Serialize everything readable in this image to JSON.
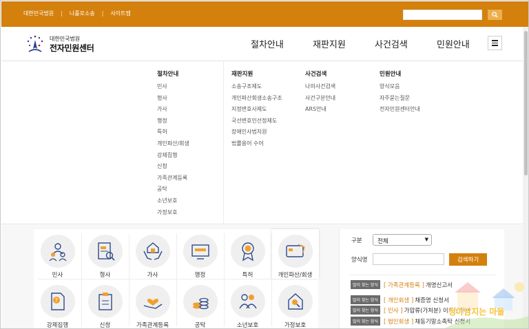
{
  "topbar": {
    "links": [
      "대한민국법원",
      "나홀로소송",
      "사이트맵"
    ]
  },
  "header": {
    "logo_org": "대한민국법원",
    "logo_name": "전자민원센터",
    "nav": [
      "절차안내",
      "재판지원",
      "사건검색",
      "민원안내"
    ]
  },
  "mega_menu": {
    "columns": [
      {
        "title": "절차안내",
        "items": [
          "민사",
          "형사",
          "가사",
          "행정",
          "특허",
          "개인파산/회생",
          "강제집행",
          "신청",
          "가족관계등록",
          "공탁",
          "소년보호",
          "가정보호"
        ]
      },
      {
        "title": "재판지원",
        "items": [
          "소송구조제도",
          "개인파산회생소송구조",
          "지정변호사제도",
          "국선변호인선정제도",
          "장애인사법지원",
          "법률용어 수어"
        ]
      },
      {
        "title": "사건검색",
        "items": [
          "나의사건검색",
          "사건구분안내",
          "ARS안내"
        ]
      },
      {
        "title": "민원안내",
        "items": [
          "양식모음",
          "자주묻는질문",
          "전자민원센터안내"
        ]
      }
    ]
  },
  "icon_tiles": [
    {
      "label": "민사",
      "icon": "people-icon"
    },
    {
      "label": "형사",
      "icon": "document-search-icon"
    },
    {
      "label": "가사",
      "icon": "house-hands-icon"
    },
    {
      "label": "행정",
      "icon": "monitor-icon"
    },
    {
      "label": "특허",
      "icon": "award-icon"
    },
    {
      "label": "개인파산/회생",
      "icon": "card-icon"
    },
    {
      "label": "강제집행",
      "icon": "doc-question-icon"
    },
    {
      "label": "신청",
      "icon": "clipboard-icon"
    },
    {
      "label": "가족관계등록",
      "icon": "heart-hand-icon"
    },
    {
      "label": "공탁",
      "icon": "coins-icon"
    },
    {
      "label": "소년보호",
      "icon": "family-icon"
    },
    {
      "label": "가정보호",
      "icon": "house-search-icon"
    }
  ],
  "form": {
    "category_label": "구분",
    "category_value": "전체",
    "form_name_label": "양식명",
    "search_button": "검색하기"
  },
  "results": [
    {
      "tag": "많이 찾는 양식",
      "category": "[ 가족관계등록 ]",
      "title": "개명신고서"
    },
    {
      "tag": "많이 찾는 양식",
      "category": "[ 개인회생 ]",
      "title": "채증명 신청서"
    },
    {
      "tag": "많이 찾는 양식",
      "category": "[ 민사 ]",
      "title": "가압류(가처분) 이의신청서"
    },
    {
      "tag": "많이 찾는 양식",
      "category": "[ 법인회생 ]",
      "title": "채동기말소촉탁 신청서"
    }
  ],
  "watermark_text": "청아남지는 마을",
  "colors": {
    "brand": "#d4800c",
    "button_light": "#ebb04f",
    "tag_bg": "#6b6b6b"
  }
}
